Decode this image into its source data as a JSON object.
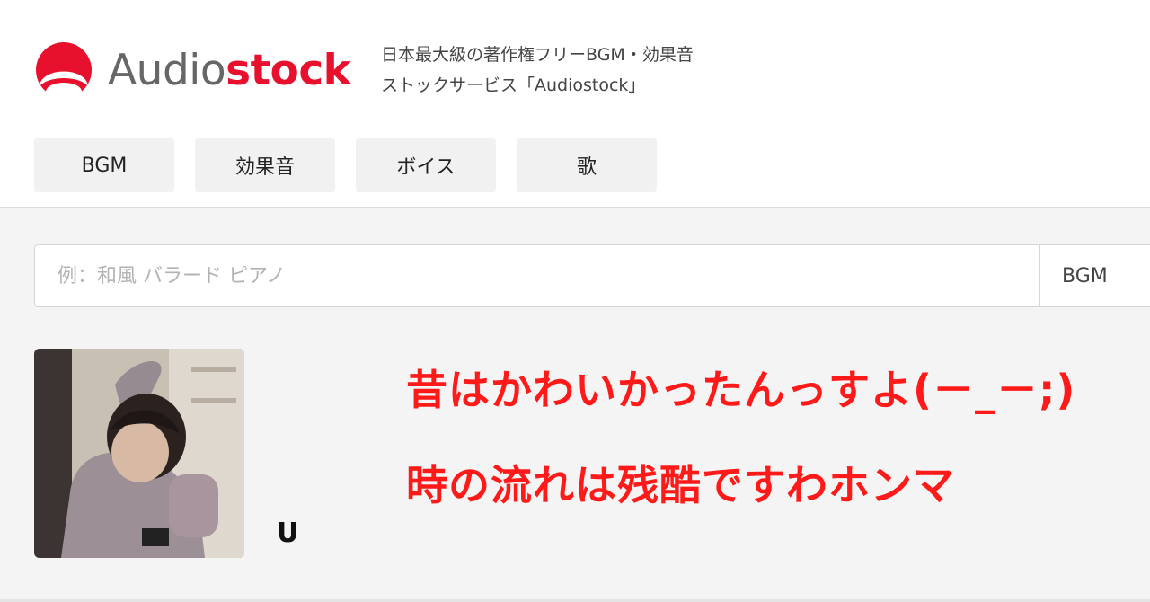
{
  "brand": {
    "name_part1": "Audio",
    "name_part2": "stock",
    "logo_icon": "audiostock-logo-icon",
    "accent_color": "#e8112d",
    "tagline_line1": "日本最大級の著作権フリーBGM・効果音",
    "tagline_line2": "ストックサービス「Audiostock」"
  },
  "categories": [
    {
      "label": "BGM"
    },
    {
      "label": "効果音"
    },
    {
      "label": "ボイス"
    },
    {
      "label": "歌"
    }
  ],
  "search": {
    "placeholder": "例：和風 バラード ピアノ",
    "type_selected": "BGM"
  },
  "profile": {
    "username": "U",
    "overlay_line1": "昔はかわいかったんっすよ(－_－;)",
    "overlay_line2": "時の流れは残酷ですわホンマ",
    "overlay_color": "#ff1a1a"
  }
}
